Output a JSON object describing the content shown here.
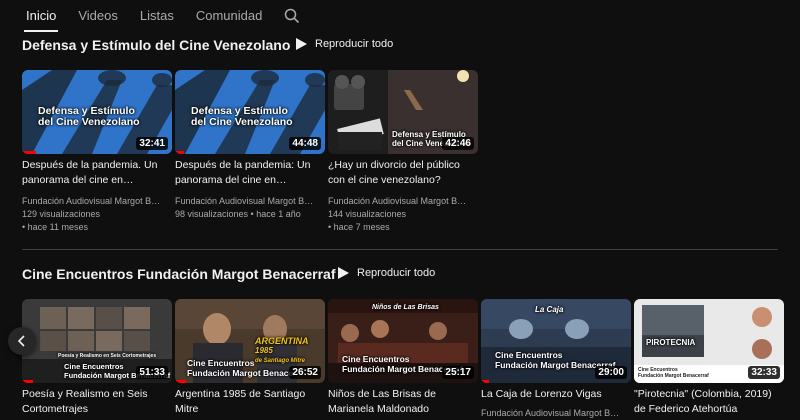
{
  "tabs": [
    {
      "label": "Inicio"
    },
    {
      "label": "Videos"
    },
    {
      "label": "Listas"
    },
    {
      "label": "Comunidad"
    }
  ],
  "icons": {
    "search": "search-icon",
    "play": "play-icon",
    "prev": "chevron-left-icon"
  },
  "colors": {
    "background": "#0f0f0f",
    "progress": "#ff0000",
    "text_secondary": "#aaaaaa"
  },
  "sections": [
    {
      "title": "Defensa y Estímulo del Cine Venezolano",
      "play_all": "Reproducir todo",
      "videos": [
        {
          "title": "Después de la pandemia. Un panorama del cine en…",
          "thumb_text": "Defensa y Estímulo\ndel Cine Venezolano",
          "duration": "32:41",
          "channel": "Fundación Audiovisual Margot B…",
          "views": "129 visualizaciones",
          "age": "• hace 11 meses",
          "watched_fraction": 0.09
        },
        {
          "title": "Después de la pandemia: Un panorama del cine en…",
          "thumb_text": "Defensa y Estímulo\ndel Cine Venezolano",
          "duration": "44:48",
          "channel": "Fundación Audiovisual Margot B…",
          "views": "98 visualizaciones • hace 1 año",
          "age": "",
          "watched_fraction": 0.06
        },
        {
          "title": "¿Hay un divorcio del público con el cine venezolano?",
          "thumb_text": "Defensa y Estímulo\ndel Cine Venezolano",
          "duration": "42:46",
          "channel": "Fundación Audiovisual Margot B…",
          "views": "144 visualizaciones",
          "age": "• hace 7 meses",
          "watched_fraction": 0
        }
      ]
    },
    {
      "title": "Cine Encuentros Fundación Margot Benacerraf",
      "play_all": "Reproducir todo",
      "videos": [
        {
          "title": "Poesía y Realismo en Seis Cortometrajes",
          "thumb_text": "Cine Encuentros\nFundación Margot Benacerraf",
          "thumb_small": "Poesía y Realismo en Seis Cortometrajes",
          "duration": "51:33",
          "watched_fraction": 0.07
        },
        {
          "title": "Argentina 1985 de Santiago Mitre",
          "thumb_text": "Cine Encuentros\nFundación Margot Benacerraf",
          "thumb_small": "ARGENTINA\n1985\nde Santiago Mitre",
          "duration": "26:52",
          "watched_fraction": 0.07
        },
        {
          "title": "Niños de Las Brisas de Marianela Maldonado",
          "thumb_text": "Cine Encuentros\nFundación Margot Benacerraf",
          "thumb_small": "Niños de Las Brisas",
          "duration": "25:17",
          "watched_fraction": 0
        },
        {
          "title": "La Caja de Lorenzo Vigas",
          "thumb_text": "Cine Encuentros\nFundación Margot Benacerraf",
          "thumb_small": "La Caja",
          "duration": "29:00",
          "channel": "Fundación Audiovisual Margot B…",
          "watched_fraction": 0.05
        },
        {
          "title": "\"Pirotecnia\" (Colombia, 2019) de Federico Atehortúa",
          "thumb_text": "Cine Encuentros\nFundación Margot Benacerraf",
          "thumb_small": "PIROTECNIA",
          "duration": "32:33",
          "watched_fraction": 0
        }
      ]
    }
  ]
}
